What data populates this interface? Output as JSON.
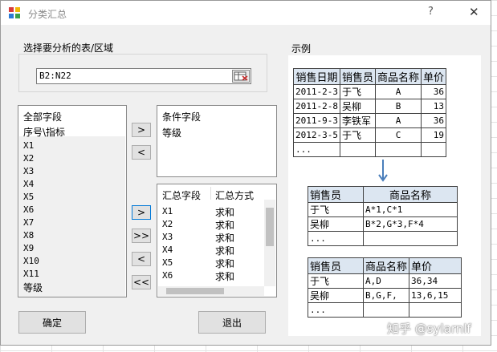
{
  "window": {
    "title": "分类汇总",
    "help_label": "?",
    "close_label": "✕"
  },
  "range_section": {
    "label": "选择要分析的表/区域",
    "value": "B2:N22"
  },
  "all_fields": {
    "header": "全部字段",
    "items": [
      "序号\\指标",
      "X1",
      "X2",
      "X3",
      "X4",
      "X5",
      "X6",
      "X7",
      "X8",
      "X9",
      "X10",
      "X11",
      "等级"
    ]
  },
  "condition_fields": {
    "header": "条件字段",
    "items": [
      "等级"
    ]
  },
  "summary_fields": {
    "header_field": "汇总字段",
    "header_method": "汇总方式",
    "rows": [
      {
        "field": "X1",
        "method": "求和"
      },
      {
        "field": "X2",
        "method": "求和"
      },
      {
        "field": "X3",
        "method": "求和"
      },
      {
        "field": "X4",
        "method": "求和"
      },
      {
        "field": "X5",
        "method": "求和"
      },
      {
        "field": "X6",
        "method": "求和"
      }
    ]
  },
  "move_buttons": {
    "cond_add": ">",
    "cond_remove": "<",
    "sum_add": ">",
    "sum_add_all": ">>",
    "sum_remove": "<",
    "sum_remove_all": "<<"
  },
  "actions": {
    "ok": "确定",
    "exit": "退出"
  },
  "example": {
    "label": "示例",
    "table1": {
      "headers": [
        "销售日期",
        "销售员",
        "商品名称",
        "单价"
      ],
      "rows": [
        [
          "2011-2-3",
          "于飞",
          "A",
          "36"
        ],
        [
          "2011-2-8",
          "吴柳",
          "B",
          "13"
        ],
        [
          "2011-9-3",
          "李铁军",
          "A",
          "36"
        ],
        [
          "2012-3-5",
          "于飞",
          "C",
          "19"
        ],
        [
          "...",
          "",
          "",
          ""
        ]
      ]
    },
    "table2": {
      "headers": [
        "销售员",
        "商品名称"
      ],
      "rows": [
        [
          "于飞",
          "A*1,C*1"
        ],
        [
          "吴柳",
          "B*2,G*3,F*4"
        ],
        [
          "...",
          ""
        ]
      ]
    },
    "table3": {
      "headers": [
        "销售员",
        "商品名称",
        "单价"
      ],
      "rows": [
        [
          "于飞",
          "A,D",
          "36,34"
        ],
        [
          "吴柳",
          "B,G,F,",
          "13,6,15"
        ],
        [
          "...",
          "",
          ""
        ]
      ]
    }
  },
  "watermark": "知乎 @sylarnlf",
  "colors": {
    "accent": "#0078d7",
    "arrow": "#4a7ebb",
    "header_fill": "#dce6f1"
  }
}
